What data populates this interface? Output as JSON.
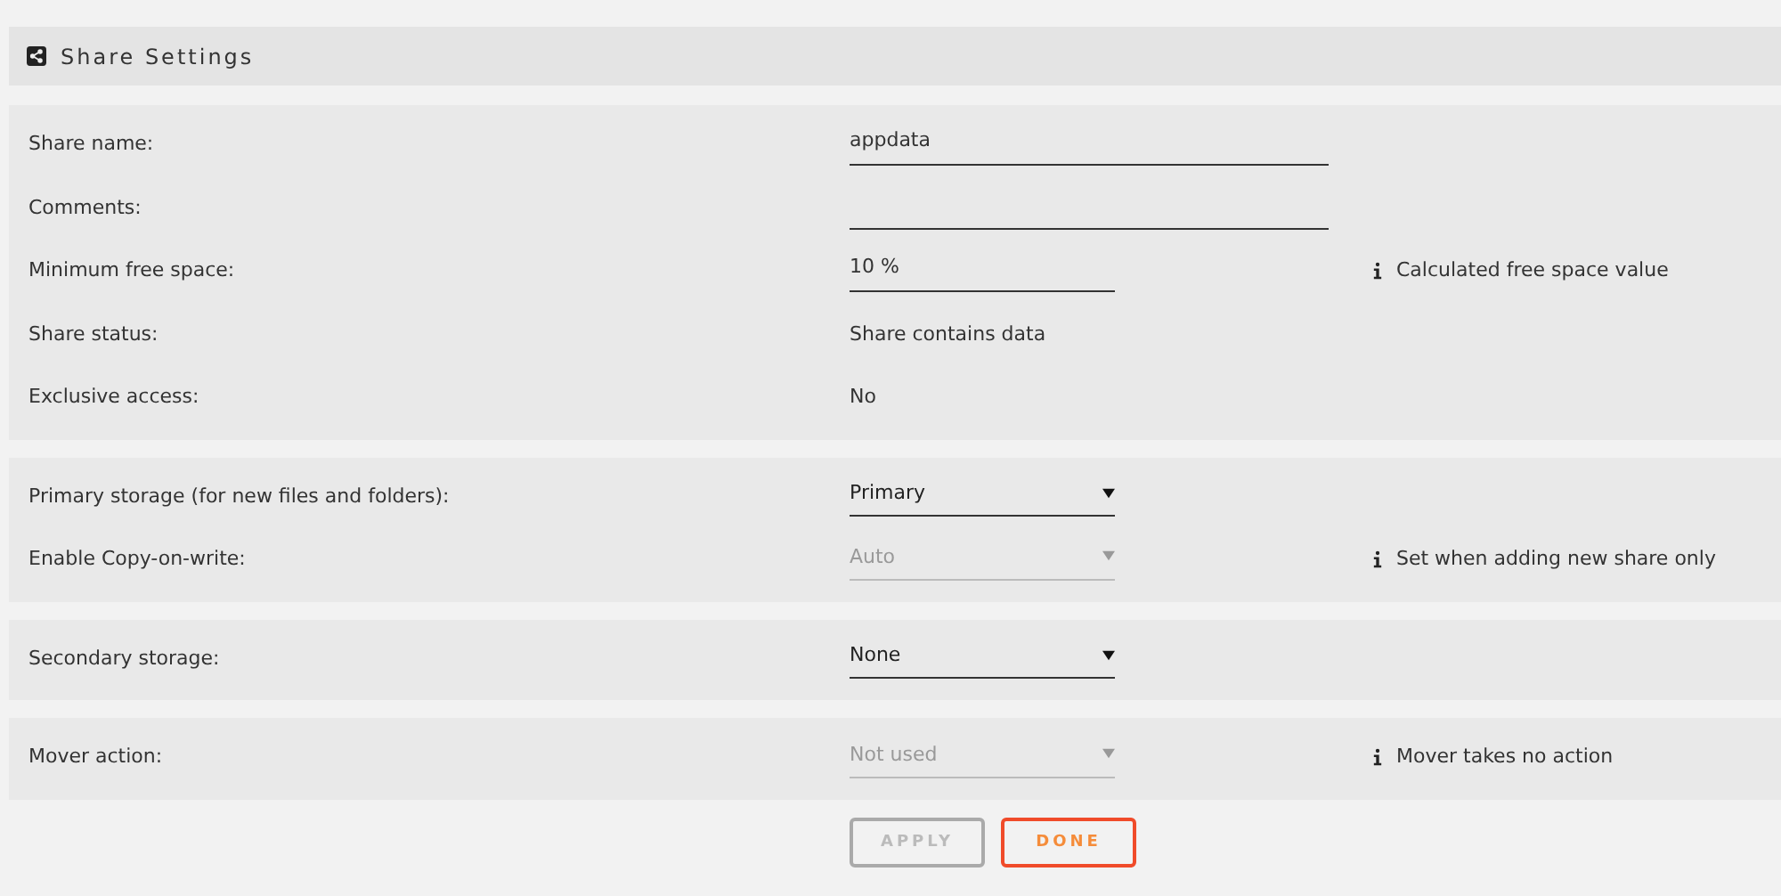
{
  "header": {
    "title": "Share Settings"
  },
  "sections": [
    {
      "rows": [
        {
          "kind": "input",
          "label": "Share name:",
          "value": "appdata"
        },
        {
          "kind": "input",
          "label": "Comments:"
        },
        {
          "kind": "number",
          "label": "Minimum free space:",
          "value": "10 %",
          "info": "Calculated free space value"
        },
        {
          "kind": "text",
          "label": "Share status:",
          "value": "Share contains data"
        },
        {
          "kind": "text",
          "label": "Exclusive access:",
          "value": "No"
        }
      ]
    },
    {
      "rows": [
        {
          "kind": "select",
          "label": "Primary storage (for new files and folders):",
          "value": "Primary",
          "disabled": false
        },
        {
          "kind": "select",
          "label": "Enable Copy-on-write:",
          "value": "Auto",
          "disabled": true,
          "info": "Set when adding new share only"
        }
      ]
    },
    {
      "rows": [
        {
          "kind": "select",
          "label": "Secondary storage:",
          "value": "None",
          "disabled": false
        }
      ]
    },
    {
      "rows": [
        {
          "kind": "select",
          "label": "Mover action:",
          "value": "Not used",
          "disabled": true,
          "info": "Mover takes no action"
        }
      ]
    }
  ],
  "buttons": [
    {
      "label": "APPLY",
      "disabled": true
    },
    {
      "label": "DONE",
      "disabled": false
    }
  ]
}
